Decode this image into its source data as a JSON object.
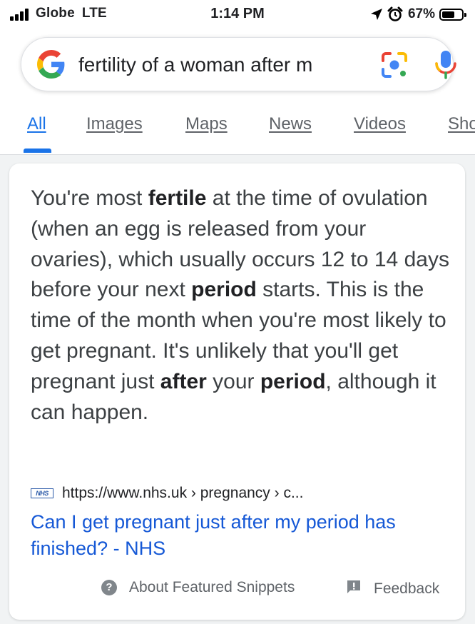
{
  "status_bar": {
    "carrier": "Globe",
    "network": "LTE",
    "time": "1:14 PM",
    "battery": "67%",
    "battery_level": 0.67,
    "icons": [
      "signal-icon",
      "location-arrow-icon",
      "alarm-icon",
      "battery-icon"
    ]
  },
  "search": {
    "query": "fertility of a woman after m",
    "icons": [
      "google-logo",
      "google-lens-icon",
      "microphone-icon"
    ]
  },
  "tabs": [
    {
      "label": "All",
      "active": true
    },
    {
      "label": "Images"
    },
    {
      "label": "Maps"
    },
    {
      "label": "News"
    },
    {
      "label": "Videos"
    },
    {
      "label": "Sho"
    }
  ],
  "featured_snippet": {
    "segments": [
      {
        "text": "You're most ",
        "bold": false
      },
      {
        "text": "fertile",
        "bold": true
      },
      {
        "text": " at the time of ovulation (when an egg is released from your ovaries), which usually occurs 12 to 14 days before your next ",
        "bold": false
      },
      {
        "text": "period",
        "bold": true
      },
      {
        "text": " starts. This is the time of the month when you're most likely to get pregnant. It's unlikely that you'll get pregnant just ",
        "bold": false
      },
      {
        "text": "after",
        "bold": true
      },
      {
        "text": " your ",
        "bold": false
      },
      {
        "text": "period",
        "bold": true
      },
      {
        "text": ", although it can happen.",
        "bold": false
      }
    ],
    "source_logo": "NHS",
    "source_url": "https://www.nhs.uk › pregnancy › c...",
    "result_title": "Can I get pregnant just after my period has finished? - NHS",
    "about_label": "About Featured Snippets",
    "feedback_label": "Feedback"
  },
  "colors": {
    "link_blue": "#1558d6",
    "tab_active": "#1a73e8",
    "page_bg": "#f1f3f4"
  }
}
